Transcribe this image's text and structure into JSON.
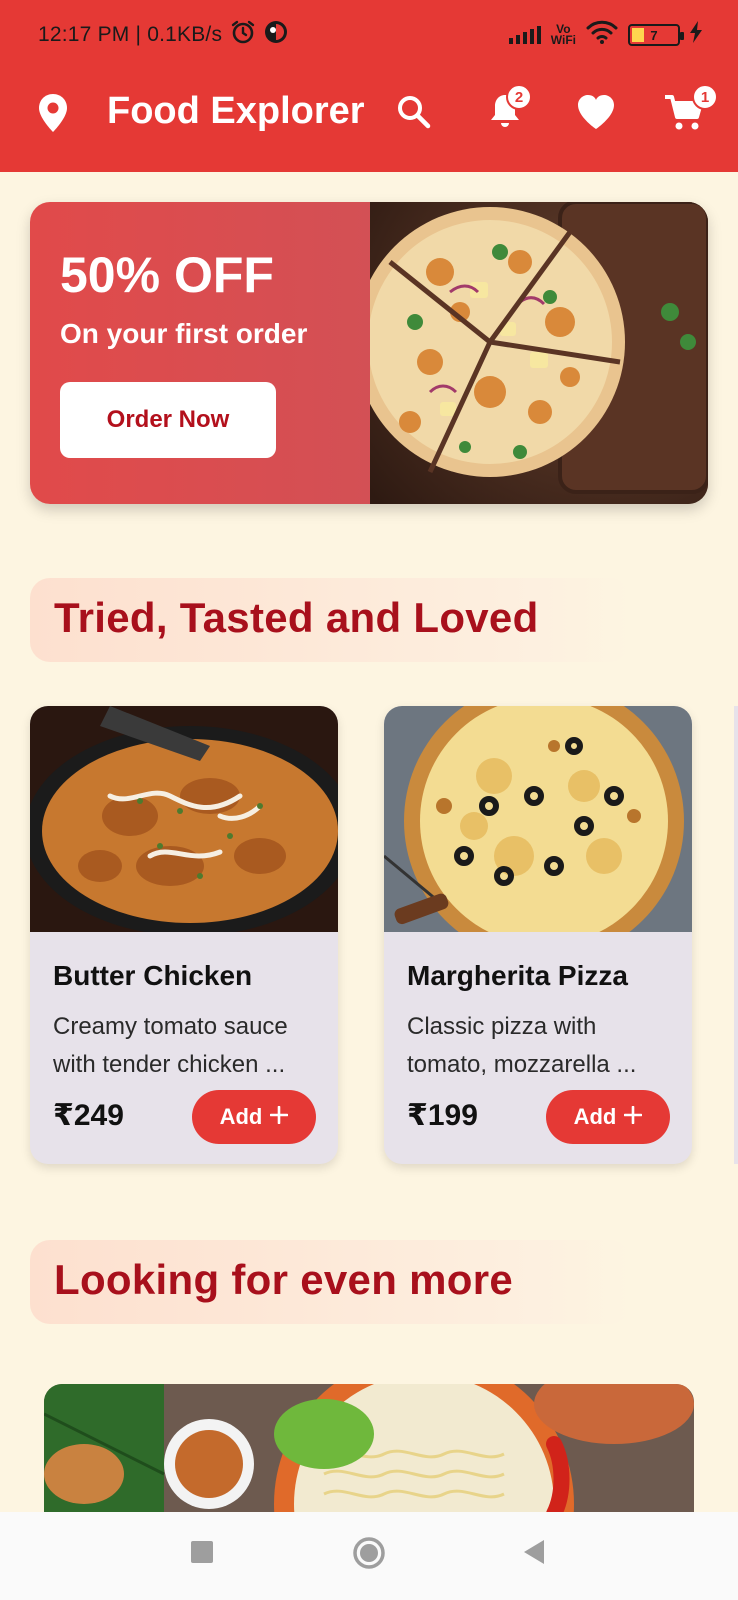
{
  "status_bar": {
    "time": "12:17 PM | 0.1KB/s",
    "vowifi_top": "Vo",
    "vowifi_bottom": "WiFi",
    "battery": "7"
  },
  "app_bar": {
    "title": "Food Explorer",
    "notifications_count": "2",
    "cart_count": "1",
    "icons": [
      "location-pin-icon",
      "search-icon",
      "bell-icon",
      "heart-icon",
      "cart-icon"
    ]
  },
  "promo": {
    "headline": "50% OFF",
    "subtitle": "On your first order",
    "button_label": "Order Now"
  },
  "sections": {
    "loved_title": "Tried, Tasted and Loved",
    "more_title": "Looking for even more"
  },
  "items": [
    {
      "name": "Butter Chicken",
      "description": "Creamy tomato sauce with tender chicken ...",
      "price": "₹249",
      "button_label": "Add"
    },
    {
      "name": "Margherita Pizza",
      "description": "Classic pizza with tomato, mozzarella ...",
      "price": "₹199",
      "button_label": "Add"
    }
  ],
  "colors": {
    "primary": "#e53935",
    "heading": "#a8101c",
    "background": "#fdf5e1",
    "card": "#e7e2ea"
  }
}
